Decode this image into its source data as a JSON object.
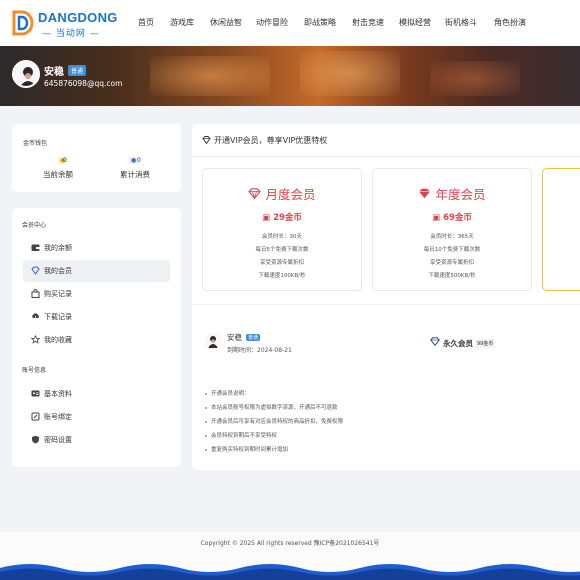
{
  "header": {
    "logo_name": "DANGDONG",
    "logo_sub": "— 当动网 —",
    "nav": [
      "首页",
      "游戏库",
      "休闲益智",
      "动作冒险",
      "即战策略",
      "射击竞速",
      "模拟经营",
      "街机格斗",
      "角色扮演"
    ]
  },
  "banner": {
    "username": "安稳",
    "badge": "普通",
    "email": "645876098@qq.com"
  },
  "wallet": {
    "title": "金币钱包",
    "balance_value": "0",
    "balance_label": "当前余额",
    "spent_value": "0",
    "spent_label": "累计消费"
  },
  "menu": {
    "section1_title": "会员中心",
    "section1_items": [
      {
        "label": "我的余额",
        "icon": "wallet-icon"
      },
      {
        "label": "我的会员",
        "icon": "diamond-icon"
      },
      {
        "label": "购买记录",
        "icon": "bag-icon"
      },
      {
        "label": "下载记录",
        "icon": "cloud-download-icon"
      },
      {
        "label": "我的收藏",
        "icon": "star-icon"
      }
    ],
    "section2_title": "账号信息",
    "section2_items": [
      {
        "label": "基本资料",
        "icon": "id-card-icon"
      },
      {
        "label": "账号绑定",
        "icon": "link-icon"
      },
      {
        "label": "密码设置",
        "icon": "shield-icon"
      }
    ]
  },
  "main": {
    "heading": "开通VIP会员，尊享VIP优惠特权",
    "plans": [
      {
        "name": "月度会员",
        "price": "29金币",
        "lines": [
          "会员时长：30天",
          "每日5个免费下载次数",
          "享受资源专属折扣",
          "下载速度100KB/秒"
        ]
      },
      {
        "name": "年度会员",
        "price": "69金币",
        "lines": [
          "会员时长：365天",
          "每日10个免费下载次数",
          "享受资源专属折扣",
          "下载速度500KB/秒"
        ]
      }
    ],
    "user": {
      "name": "安稳",
      "badge": "普通",
      "expire": "到期时间：2024-08-21"
    },
    "forever": {
      "label": "永久会员",
      "price": "99金币"
    },
    "notes": [
      "开通会员说明：",
      "本站会员账号权限为虚拟数字资源，开通后不可退款",
      "开通会员后可享有对应会员特权的商品折扣，免费权限",
      "会员特权到期后不享受特权",
      "重复购买特权到期时间累计增加"
    ]
  },
  "footer": {
    "text": "Copyright © 2025 All rights reserved  豫ICP备2021026541号"
  },
  "colors": {
    "brand": "#1a73c8",
    "accent_red": "#d9444c",
    "badge_blue": "#3a8fd6",
    "gold_border": "#f0c040"
  }
}
